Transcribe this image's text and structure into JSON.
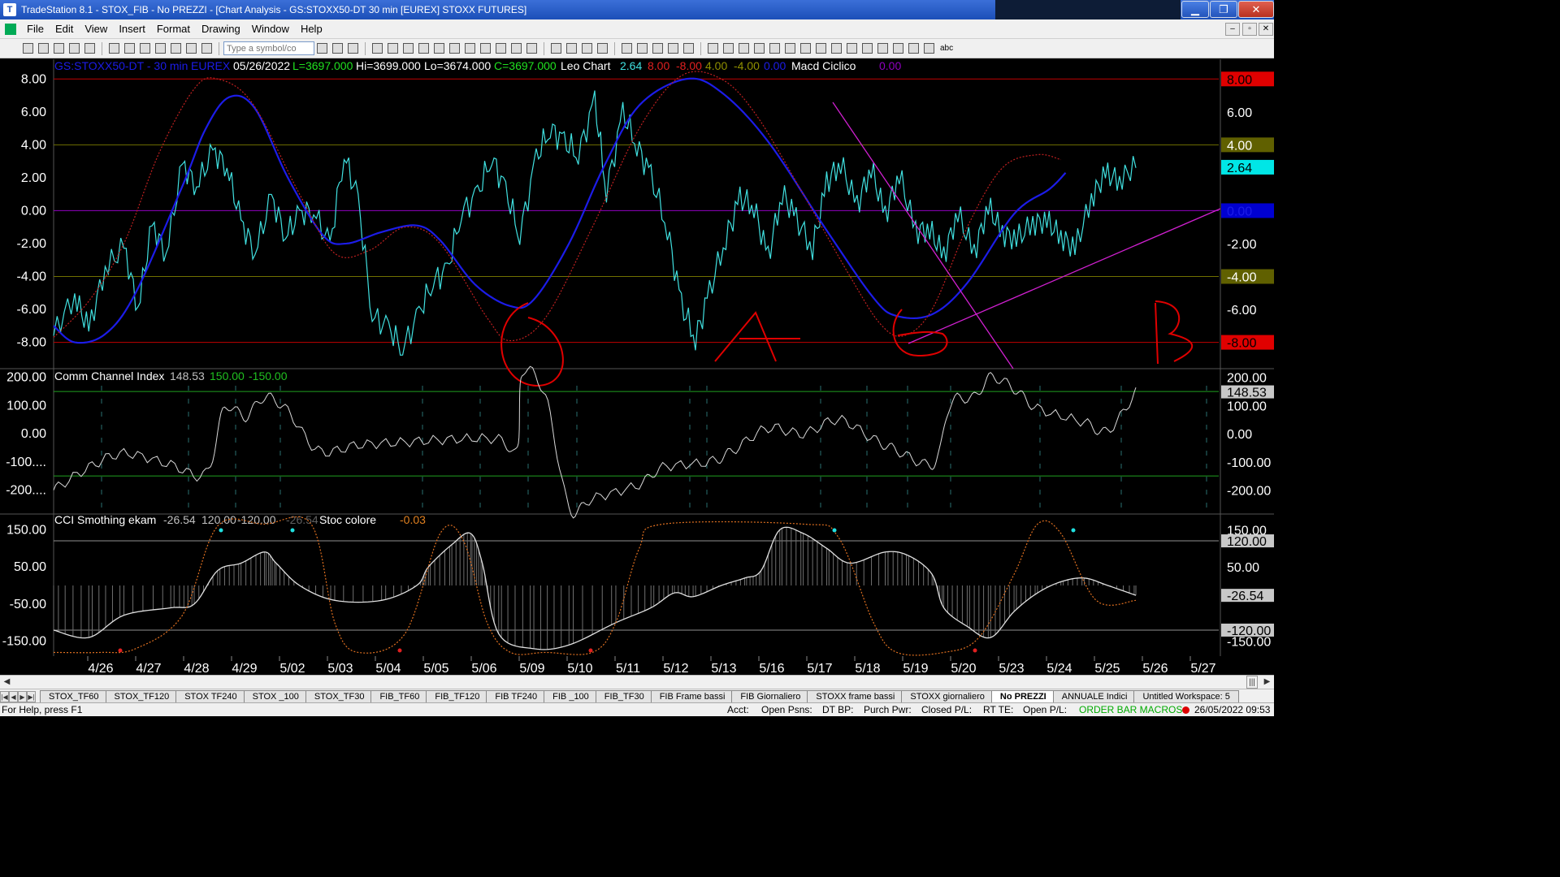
{
  "window": {
    "title": "TradeStation 8.1 - STOX_FIB - No PREZZI - [Chart Analysis - GS:STOXX50-DT  30 min  [EUREX] STOXX FUTURES]",
    "minimize": "▁",
    "restore": "❐",
    "close": "✕"
  },
  "menu": [
    "File",
    "Edit",
    "View",
    "Insert",
    "Format",
    "Drawing",
    "Window",
    "Help"
  ],
  "mdi_buttons": [
    "‒",
    "▫",
    "✕"
  ],
  "toolbar": {
    "symbol_placeholder": "Type a symbol/co",
    "abc_label": "abc"
  },
  "chart_data": [
    {
      "type": "line",
      "pane": "price",
      "header": {
        "symbol": "GS:STOXX50-DT - 30 min",
        "exchange": "EUREX",
        "date": "05/26/2022",
        "last": "L=3697.000",
        "high": "Hi=3699.000",
        "low": "Lo=3674.000",
        "close": "C=3697.000",
        "indicator1": "Leo Chart",
        "ind1_values": [
          "2.64",
          "8.00",
          "-8.00",
          "4.00",
          "-4.00",
          "0.00"
        ],
        "indicator2": "Macd Ciclico",
        "ind2_value": "0.00"
      },
      "y_ticks": [
        "8.00",
        "6.00",
        "4.00",
        "2.00",
        "0.00",
        "-2.00",
        "-4.00",
        "-6.00",
        "-8.00"
      ],
      "ylim": [
        -9.6,
        9.0
      ],
      "levels": [
        8,
        4,
        0,
        -4,
        -8
      ],
      "right_labels": [
        {
          "value": 8,
          "text": "8.00",
          "color": "#e00000"
        },
        {
          "value": 6,
          "text": "6.00",
          "color": ""
        },
        {
          "value": 4,
          "text": "4.00",
          "color": "#606000"
        },
        {
          "value": 2.64,
          "text": "2.64",
          "color": "#00e6e6"
        },
        {
          "value": 0,
          "text": "0.00",
          "color": "#0000d0"
        },
        {
          "value": -2,
          "text": "-2.00",
          "color": ""
        },
        {
          "value": -4,
          "text": "-4.00",
          "color": "#606000"
        },
        {
          "value": -6,
          "text": "-6.00",
          "color": ""
        },
        {
          "value": -8,
          "text": "-8.00",
          "color": "#e00000"
        }
      ],
      "series": [
        {
          "color": "#40e0e0",
          "x": [
            0,
            0.9,
            1.5,
            2.2,
            3.0,
            3.6,
            4.2,
            4.8,
            5.5,
            6.1,
            6.8,
            7.4,
            8.0,
            8.6,
            9.3,
            9.9,
            10.5,
            11.1,
            11.8,
            12.4,
            13.0,
            13.6,
            14.3,
            14.9,
            15.6,
            16.2,
            16.8,
            17.4,
            18.1,
            18.7,
            19.3,
            19.9,
            20.6,
            21.2,
            21.8,
            22.4,
            23.1,
            23.6
          ],
          "y": [
            -7.6,
            -5.0,
            -7.4,
            -3.3,
            -2.4,
            -5.7,
            -1.1,
            -2.4,
            2.6,
            1.7,
            3.4,
            2.9,
            -0.9,
            -2.3,
            0.6,
            -1.3,
            -0.4,
            0.2,
            -2.3,
            3.6,
            0.5,
            -6.2,
            -7.3,
            -8.2,
            -6.4,
            -4.1,
            -3.8,
            0.0,
            0.9,
            3.4,
            1.1,
            -1.4,
            3.1,
            5.1,
            4.1,
            3.5,
            6.6,
            1.2
          ],
          "x2": [
            23.6,
            24.3,
            24.9,
            25.5,
            26.2,
            26.8,
            27.4,
            28.0,
            28.7,
            29.3,
            29.9,
            30.5,
            31.1,
            31.7,
            32.4,
            33.0,
            33.6,
            34.3,
            34.9,
            35.5,
            36.1,
            36.8,
            37.4,
            38.0,
            38.6,
            39.3,
            39.9,
            40.5,
            41.1,
            41.8,
            42.4,
            43.0,
            43.6,
            44.3,
            44.9,
            45.5,
            46.2
          ],
          "y2": [
            1.2,
            5.9,
            4.0,
            2.1,
            -1.1,
            -5.7,
            -7.8,
            -4.9,
            -1.7,
            0.8,
            0.2,
            -2.8,
            1.0,
            -0.4,
            -2.4,
            1.8,
            2.8,
            0.4,
            2.5,
            -0.2,
            2.1,
            -1.1,
            -1.3,
            -2.6,
            -0.3,
            -2.4,
            0.1,
            -1.2,
            -1.9,
            -0.6,
            -0.8,
            -1.4,
            -2.5,
            0.9,
            2.1,
            2.0,
            2.6
          ]
        },
        {
          "name": "",
          "color": "#1c1ce8"
        },
        {
          "name": "",
          "color": "#c02020"
        }
      ]
    },
    {
      "type": "line",
      "pane": "cci",
      "header": {
        "name": "Comm Channel Index",
        "value": "148.53",
        "upper": "150.00",
        "lower": "-150.00"
      },
      "y_ticks": [
        "200.00",
        "100.00",
        "0.00",
        "-100....",
        "-200...."
      ],
      "right_labels": [
        "200.00",
        "148.53",
        "100.00",
        "0.00",
        "-100.00",
        "-200.00"
      ],
      "ylim": [
        -285,
        228
      ],
      "levels": [
        150,
        -150
      ],
      "last": 148.53
    },
    {
      "type": "line",
      "pane": "cci_smoothing",
      "header": {
        "name": "CCI Smothing ekam",
        "value": "-26.54",
        "upper": "120.00",
        "lower": "-120.00",
        "extra": "-26.54",
        "name2": "Stoc colore",
        "value2": "-0.03"
      },
      "y_ticks": [
        "150.00",
        "50.00",
        "-50.00",
        "-150.00"
      ],
      "right_labels": [
        "150.00",
        "120.00",
        "50.00",
        "-26.54",
        "-120.00",
        "-150.00"
      ],
      "ylim": [
        -190,
        190
      ],
      "levels": [
        120,
        -120
      ]
    }
  ],
  "x_axis": {
    "dates": [
      "4/26",
      "4/27",
      "4/28",
      "4/29",
      "5/02",
      "5/03",
      "5/04",
      "5/05",
      "5/06",
      "5/09",
      "5/10",
      "5/11",
      "5/12",
      "5/13",
      "5/16",
      "5/17",
      "5/18",
      "5/19",
      "5/20",
      "5/23",
      "5/24",
      "5/25",
      "5/26",
      "5/27"
    ]
  },
  "tabs": [
    "STOX_TF60",
    "STOX_TF120",
    "STOX TF240",
    "STOX _100",
    "STOX_TF30",
    "FIB_TF60",
    "FIB_TF120",
    "FIB TF240",
    "FIB _100",
    "FIB_TF30",
    "FIB Frame bassi",
    "FIB Giornaliero",
    "STOXX frame bassi",
    "STOXX giornaliero",
    "No PREZZI",
    "ANNUALE Indici",
    "Untitled Workspace: 5"
  ],
  "status": {
    "help": "For Help, press F1",
    "acct": "Acct:",
    "psns": "Open Psns:",
    "dtbp": "DT BP:",
    "purch": "Purch Pwr:",
    "closed": "Closed P/L:",
    "rtte": "RT TE:",
    "openpl": "Open P/L:",
    "macros": "ORDER BAR  MACROS",
    "datetime": "26/05/2022 09:53"
  }
}
